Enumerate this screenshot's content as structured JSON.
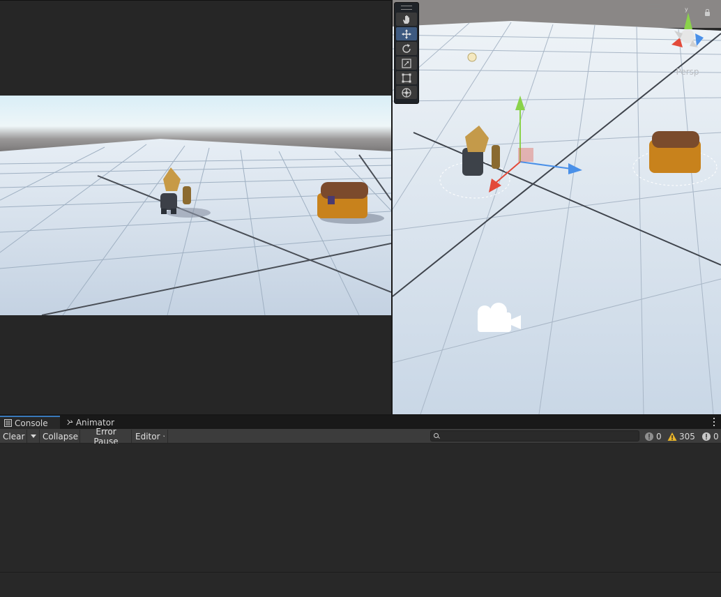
{
  "scene": {
    "camera_mode": "Persp",
    "tools": [
      "hand-tool",
      "move-tool",
      "rotate-tool",
      "scale-tool",
      "rect-tool",
      "transform-tool"
    ],
    "active_tool": "move-tool"
  },
  "tabs": {
    "console": "Console",
    "animator": "Animator"
  },
  "toolbar": {
    "clear": "Clear",
    "collapse": "Collapse",
    "error_pause": "Error Pause",
    "editor": "Editor",
    "search_value": ""
  },
  "counts": {
    "info": "0",
    "warnings": "305",
    "errors": "0"
  },
  "colors": {
    "accent": "#3a79bb",
    "active_tool": "#3e5a80",
    "warning": "#e8b42a"
  }
}
